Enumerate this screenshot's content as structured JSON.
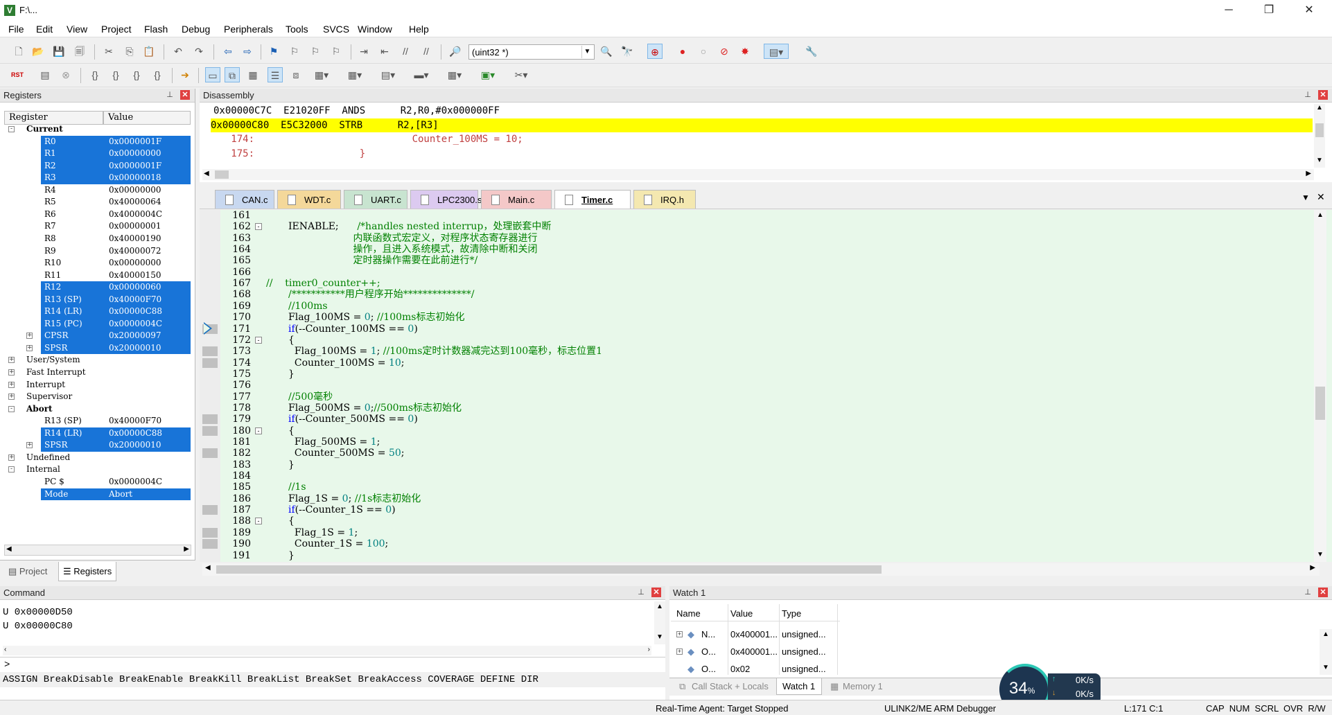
{
  "window": {
    "title": "F:\\...",
    "app_icon": "V"
  },
  "menu": [
    "File",
    "Edit",
    "View",
    "Project",
    "Flash",
    "Debug",
    "Peripherals",
    "Tools",
    "SVCS",
    "Window",
    "Help"
  ],
  "toolbar": {
    "combo_value": "(uint32 *)",
    "rst_label": "RST"
  },
  "registers": {
    "title": "Registers",
    "col_register": "Register",
    "col_value": "Value",
    "rows": [
      {
        "indent": 0,
        "exp": "-",
        "name": "Current",
        "value": "",
        "bold": true,
        "hl": false
      },
      {
        "indent": 2,
        "exp": "",
        "name": "R0",
        "value": "0x0000001F",
        "hl": true
      },
      {
        "indent": 2,
        "exp": "",
        "name": "R1",
        "value": "0x00000000",
        "hl": true
      },
      {
        "indent": 2,
        "exp": "",
        "name": "R2",
        "value": "0x0000001F",
        "hl": true
      },
      {
        "indent": 2,
        "exp": "",
        "name": "R3",
        "value": "0x00000018",
        "hl": true
      },
      {
        "indent": 2,
        "exp": "",
        "name": "R4",
        "value": "0x00000000",
        "hl": false
      },
      {
        "indent": 2,
        "exp": "",
        "name": "R5",
        "value": "0x40000064",
        "hl": false
      },
      {
        "indent": 2,
        "exp": "",
        "name": "R6",
        "value": "0x4000004C",
        "hl": false
      },
      {
        "indent": 2,
        "exp": "",
        "name": "R7",
        "value": "0x00000001",
        "hl": false
      },
      {
        "indent": 2,
        "exp": "",
        "name": "R8",
        "value": "0x40000190",
        "hl": false
      },
      {
        "indent": 2,
        "exp": "",
        "name": "R9",
        "value": "0x40000072",
        "hl": false
      },
      {
        "indent": 2,
        "exp": "",
        "name": "R10",
        "value": "0x00000000",
        "hl": false
      },
      {
        "indent": 2,
        "exp": "",
        "name": "R11",
        "value": "0x40000150",
        "hl": false
      },
      {
        "indent": 2,
        "exp": "",
        "name": "R12",
        "value": "0x00000060",
        "hl": true
      },
      {
        "indent": 2,
        "exp": "",
        "name": "R13 (SP)",
        "value": "0x40000F70",
        "hl": true
      },
      {
        "indent": 2,
        "exp": "",
        "name": "R14 (LR)",
        "value": "0x00000C88",
        "hl": true
      },
      {
        "indent": 2,
        "exp": "",
        "name": "R15 (PC)",
        "value": "0x0000004C",
        "hl": true
      },
      {
        "indent": 2,
        "exp": "+",
        "name": "CPSR",
        "value": "0x20000097",
        "hl": true
      },
      {
        "indent": 2,
        "exp": "+",
        "name": "SPSR",
        "value": "0x20000010",
        "hl": true
      },
      {
        "indent": 0,
        "exp": "+",
        "name": "User/System",
        "value": "",
        "hl": false
      },
      {
        "indent": 0,
        "exp": "+",
        "name": "Fast Interrupt",
        "value": "",
        "hl": false
      },
      {
        "indent": 0,
        "exp": "+",
        "name": "Interrupt",
        "value": "",
        "hl": false
      },
      {
        "indent": 0,
        "exp": "+",
        "name": "Supervisor",
        "value": "",
        "hl": false
      },
      {
        "indent": 0,
        "exp": "-",
        "name": "Abort",
        "value": "",
        "bold": true,
        "hl": false
      },
      {
        "indent": 2,
        "exp": "",
        "name": "R13 (SP)",
        "value": "0x40000F70",
        "hl": false
      },
      {
        "indent": 2,
        "exp": "",
        "name": "R14 (LR)",
        "value": "0x00000C88",
        "hl": true
      },
      {
        "indent": 2,
        "exp": "+",
        "name": "SPSR",
        "value": "0x20000010",
        "hl": true
      },
      {
        "indent": 0,
        "exp": "+",
        "name": "Undefined",
        "value": "",
        "hl": false
      },
      {
        "indent": 0,
        "exp": "-",
        "name": "Internal",
        "value": "",
        "hl": false
      },
      {
        "indent": 2,
        "exp": "",
        "name": "PC  $",
        "value": "0x0000004C",
        "hl": false
      },
      {
        "indent": 2,
        "exp": "",
        "name": "Mode",
        "value": "Abort",
        "hl": true
      }
    ],
    "bottom_tabs": [
      "Project",
      "Registers"
    ]
  },
  "disassembly": {
    "title": "Disassembly",
    "lines": [
      {
        "text": "0x00000C7C  E21020FF  ANDS      R2,R0,#0x000000FF",
        "hl": false,
        "color": "#000000"
      },
      {
        "text": "0x00000C80  E5C32000  STRB      R2,[R3]",
        "hl": true,
        "color": "#000000"
      },
      {
        "text": "   174:                           Counter_100MS = 10;",
        "hl": false,
        "color": "#c04040"
      },
      {
        "text": "   175:                  }",
        "hl": false,
        "color": "#c04040"
      }
    ]
  },
  "tabs": [
    {
      "label": "CAN.c",
      "color": "#c8d8f0",
      "active": false
    },
    {
      "label": "WDT.c",
      "color": "#f4d89a",
      "active": false
    },
    {
      "label": "UART.c",
      "color": "#c8e4d0",
      "active": false
    },
    {
      "label": "LPC2300.s",
      "color": "#dccaf0",
      "active": false
    },
    {
      "label": "Main.c",
      "color": "#f4c8c8",
      "active": false
    },
    {
      "label": "Timer.c",
      "color": "#f4f0d0",
      "active": true
    },
    {
      "label": "IRQ.h",
      "color": "#f4e8b0",
      "active": false
    }
  ],
  "editor": {
    "lines": [
      {
        "n": "161",
        "html": ""
      },
      {
        "n": "162",
        "html": "IENABLE;      <span class='cm'>/*handles nested interrup，处理嵌套中断</span>",
        "fold": "-"
      },
      {
        "n": "163",
        "html": "<span class='cm'>                     内联函数式宏定义，对程序状态寄存器进行</span>"
      },
      {
        "n": "164",
        "html": "<span class='cm'>                     操作，且进入系统模式，故清除中断和关闭</span>"
      },
      {
        "n": "165",
        "html": "<span class='cm'>                     定时器操作需要在此前进行*/</span>"
      },
      {
        "n": "166",
        "html": ""
      },
      {
        "n": "167",
        "html": "<span class='cm'>//    timer0_counter++;</span>",
        "shift": true
      },
      {
        "n": "168",
        "html": "<span class='cm'>/***********用户程序开始**************/</span>"
      },
      {
        "n": "169",
        "html": "<span class='cm'>//100ms</span>"
      },
      {
        "n": "170",
        "html": "Flag_100MS = <span class='nu'>0</span>; <span class='cm'>//100ms标志初始化</span>"
      },
      {
        "n": "171",
        "html": "<span class='kw'>if</span>(--Counter_100MS == <span class='nu'>0</span>)"
      },
      {
        "n": "172",
        "html": "{",
        "fold": "-"
      },
      {
        "n": "173",
        "html": "  Flag_100MS = <span class='nu'>1</span>; <span class='cm'>//100ms定时计数器减完达到100毫秒，标志位置1</span>"
      },
      {
        "n": "174",
        "html": "  Counter_100MS = <span class='nu'>10</span>;"
      },
      {
        "n": "175",
        "html": "}"
      },
      {
        "n": "176",
        "html": ""
      },
      {
        "n": "177",
        "html": "<span class='cm'>//500毫秒</span>"
      },
      {
        "n": "178",
        "html": "Flag_500MS = <span class='nu'>0</span>;<span class='cm'>//500ms标志初始化</span>"
      },
      {
        "n": "179",
        "html": "<span class='kw'>if</span>(--Counter_500MS == <span class='nu'>0</span>)"
      },
      {
        "n": "180",
        "html": "{",
        "fold": "-"
      },
      {
        "n": "181",
        "html": "  Flag_500MS = <span class='nu'>1</span>;"
      },
      {
        "n": "182",
        "html": "  Counter_500MS = <span class='nu'>50</span>;"
      },
      {
        "n": "183",
        "html": "}"
      },
      {
        "n": "184",
        "html": ""
      },
      {
        "n": "185",
        "html": "<span class='cm'>//1s</span>"
      },
      {
        "n": "186",
        "html": "Flag_1S = <span class='nu'>0</span>; <span class='cm'>//1s标志初始化</span>"
      },
      {
        "n": "187",
        "html": "<span class='kw'>if</span>(--Counter_1S == <span class='nu'>0</span>)"
      },
      {
        "n": "188",
        "html": "{",
        "fold": "-"
      },
      {
        "n": "189",
        "html": "  Flag_1S = <span class='nu'>1</span>;"
      },
      {
        "n": "190",
        "html": "  Counter_1S = <span class='nu'>100</span>;"
      },
      {
        "n": "191",
        "html": "}"
      }
    ]
  },
  "command": {
    "title": "Command",
    "lines": [
      "U 0x00000D50",
      "U 0x00000C80"
    ],
    "prompt": ">",
    "hints": "ASSIGN BreakDisable BreakEnable BreakKill BreakList BreakSet BreakAccess COVERAGE DEFINE DIR"
  },
  "watch": {
    "title": "Watch 1",
    "columns": [
      "Name",
      "Value",
      "Type"
    ],
    "rows": [
      {
        "name": "N...",
        "value": "0x400001...",
        "type": "unsigned..."
      },
      {
        "name": "O...",
        "value": "0x400001...",
        "type": "unsigned..."
      },
      {
        "name": "O...",
        "value": "0x02",
        "type": "unsigned..."
      }
    ],
    "tabs": [
      "Call Stack + Locals",
      "Watch 1",
      "Memory 1"
    ]
  },
  "status": {
    "agent": "Real-Time Agent: Target Stopped",
    "debugger": "ULINK2/ME ARM Debugger",
    "position": "L:171 C:1",
    "indicators": "CAP  NUM  SCRL  OVR  R/W"
  },
  "netmeter": {
    "percent": "34",
    "unit": "%",
    "up": "0K/s",
    "down": "0K/s"
  }
}
